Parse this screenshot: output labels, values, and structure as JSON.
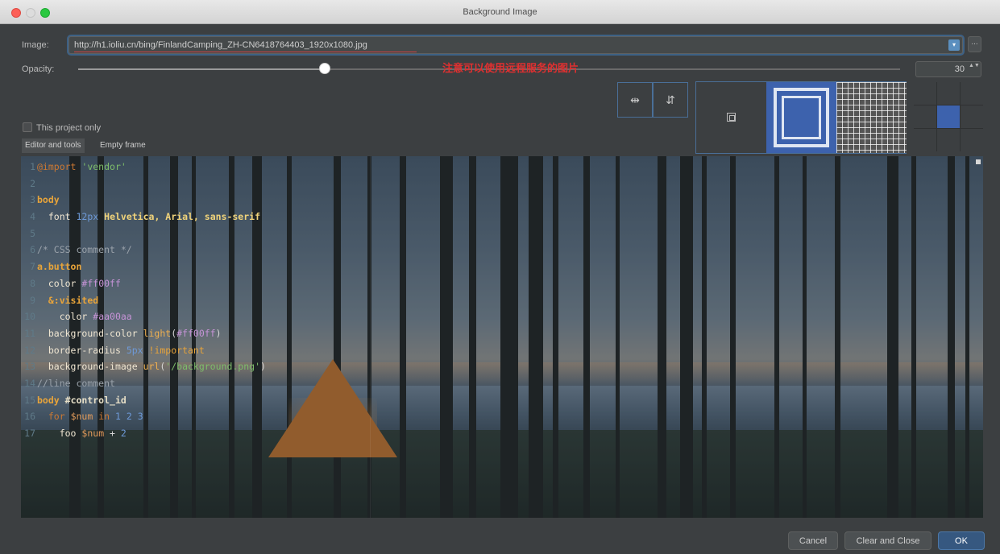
{
  "window": {
    "title": "Background Image"
  },
  "image": {
    "label": "Image:",
    "url": "http://h1.ioliu.cn/bing/FinlandCamping_ZH-CN6418764403_1920x1080.jpg",
    "dropdown_glyph": "▾",
    "browse_glyph": "..."
  },
  "opacity": {
    "label": "Opacity:",
    "value": "30",
    "percent": 30,
    "spinner_glyph": "▲▼"
  },
  "annotation": "注意可以使用远程服务的图片",
  "flip": {
    "horizontal_glyph": "⇹",
    "vertical_glyph": "⇵"
  },
  "project_only": {
    "label": "This project only",
    "checked": false
  },
  "tabs": [
    {
      "label": "Editor and tools",
      "active": true
    },
    {
      "label": "Empty frame",
      "active": false
    }
  ],
  "anchor": {
    "selected": "center"
  },
  "code_lines": [
    {
      "n": "1",
      "tokens": [
        [
          "at",
          "@import"
        ],
        [
          "plain",
          " "
        ],
        [
          "str",
          "'vendor'"
        ]
      ]
    },
    {
      "n": "2",
      "tokens": []
    },
    {
      "n": "3",
      "tokens": [
        [
          "sel",
          "body"
        ]
      ]
    },
    {
      "n": "4",
      "tokens": [
        [
          "plain",
          "  "
        ],
        [
          "prop",
          "font"
        ],
        [
          "plain",
          " "
        ],
        [
          "num",
          "12px"
        ],
        [
          "plain",
          " "
        ],
        [
          "val",
          "Helvetica, Arial, sans-serif"
        ]
      ]
    },
    {
      "n": "5",
      "tokens": []
    },
    {
      "n": "6",
      "tokens": [
        [
          "com",
          "/* CSS comment */"
        ]
      ]
    },
    {
      "n": "7",
      "tokens": [
        [
          "sel",
          "a.button"
        ]
      ]
    },
    {
      "n": "8",
      "tokens": [
        [
          "plain",
          "  "
        ],
        [
          "prop",
          "color"
        ],
        [
          "plain",
          " "
        ],
        [
          "hex",
          "#ff00ff"
        ]
      ]
    },
    {
      "n": "9",
      "tokens": [
        [
          "plain",
          "  "
        ],
        [
          "sel",
          "&:visited"
        ]
      ]
    },
    {
      "n": "10",
      "tokens": [
        [
          "plain",
          "    "
        ],
        [
          "prop",
          "color"
        ],
        [
          "plain",
          " "
        ],
        [
          "hex",
          "#aa00aa"
        ]
      ]
    },
    {
      "n": "11",
      "tokens": [
        [
          "plain",
          "  "
        ],
        [
          "prop",
          "background-color"
        ],
        [
          "plain",
          " "
        ],
        [
          "fn",
          "light"
        ],
        [
          "plain",
          "("
        ],
        [
          "hex",
          "#ff00ff"
        ],
        [
          "plain",
          ")"
        ]
      ]
    },
    {
      "n": "12",
      "tokens": [
        [
          "plain",
          "  "
        ],
        [
          "prop",
          "border-radius"
        ],
        [
          "plain",
          " "
        ],
        [
          "num",
          "5px"
        ],
        [
          "plain",
          " "
        ],
        [
          "imp",
          "!important"
        ]
      ]
    },
    {
      "n": "13",
      "tokens": [
        [
          "plain",
          "  "
        ],
        [
          "prop",
          "background-image"
        ],
        [
          "plain",
          " "
        ],
        [
          "fn",
          "url"
        ],
        [
          "plain",
          "("
        ],
        [
          "str",
          "'/background.png'"
        ],
        [
          "plain",
          ")"
        ]
      ]
    },
    {
      "n": "14",
      "tokens": [
        [
          "com",
          "//line comment"
        ]
      ]
    },
    {
      "n": "15",
      "tokens": [
        [
          "sel",
          "body"
        ],
        [
          "plain",
          " "
        ],
        [
          "id",
          "#control_id"
        ]
      ]
    },
    {
      "n": "16",
      "tokens": [
        [
          "plain",
          "  "
        ],
        [
          "at",
          "for"
        ],
        [
          "plain",
          " "
        ],
        [
          "var",
          "$num"
        ],
        [
          "plain",
          " "
        ],
        [
          "at",
          "in"
        ],
        [
          "plain",
          " "
        ],
        [
          "num",
          "1 2 3"
        ]
      ]
    },
    {
      "n": "17",
      "tokens": [
        [
          "plain",
          "    "
        ],
        [
          "prop",
          "foo"
        ],
        [
          "plain",
          " "
        ],
        [
          "var",
          "$num"
        ],
        [
          "plain",
          " + "
        ],
        [
          "num",
          "2"
        ]
      ]
    }
  ],
  "buttons": {
    "cancel": "Cancel",
    "clear_close": "Clear and Close",
    "ok": "OK"
  },
  "colors": {
    "accent": "#365880",
    "selection": "#3d62ad",
    "annotation": "#e03030"
  }
}
